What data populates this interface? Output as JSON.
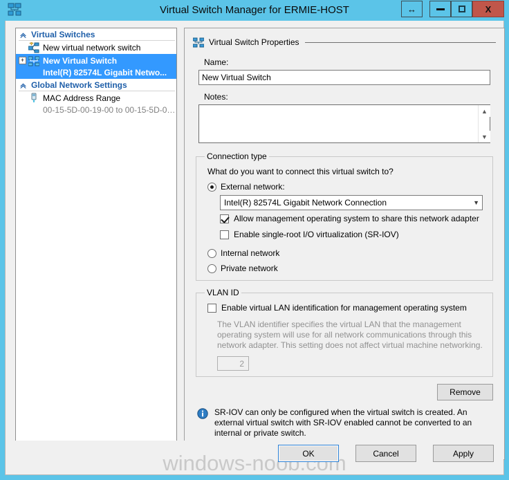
{
  "window": {
    "title": "Virtual Switch Manager for ERMIE-HOST",
    "app_icon": "virtual-switch-icon",
    "buttons": {
      "restore_label": "↔",
      "minimize_label": "",
      "maximize_label": "",
      "close_label": "X"
    }
  },
  "tree": {
    "sections": [
      {
        "label": "Virtual Switches",
        "items": [
          {
            "label": "New virtual network switch",
            "icon": "new-virtual-switch-icon",
            "selected": false,
            "sub": null,
            "expander": null
          },
          {
            "label": "New Virtual Switch",
            "icon": "virtual-switch-icon",
            "selected": true,
            "sub": "Intel(R) 82574L Gigabit Netwo...",
            "expander": "+"
          }
        ]
      },
      {
        "label": "Global Network Settings",
        "items": [
          {
            "label": "MAC Address Range",
            "icon": "mac-address-icon",
            "selected": false,
            "sub": "00-15-5D-00-19-00 to 00-15-5D-0…",
            "expander": null
          }
        ]
      }
    ]
  },
  "properties": {
    "header": "Virtual Switch Properties",
    "name_label": "Name:",
    "name_value": "New Virtual Switch",
    "notes_label": "Notes:",
    "notes_value": ""
  },
  "connection_type": {
    "legend": "Connection type",
    "question": "What do you want to connect this virtual switch to?",
    "external_label": "External network:",
    "external_selected": true,
    "adapter_value": "Intel(R) 82574L Gigabit Network Connection",
    "allow_management_label": "Allow management operating system to share this network adapter",
    "allow_management_checked": true,
    "sriov_label": "Enable single-root I/O virtualization (SR-IOV)",
    "sriov_checked": false,
    "internal_label": "Internal network",
    "internal_selected": false,
    "private_label": "Private network",
    "private_selected": false
  },
  "vlan": {
    "legend": "VLAN ID",
    "enable_label": "Enable virtual LAN identification for management operating system",
    "enable_checked": false,
    "description": "The VLAN identifier specifies the virtual LAN that the management operating system will use for all network communications through this network adapter. This setting does not affect virtual machine networking.",
    "id_value": "2"
  },
  "actions": {
    "remove_label": "Remove"
  },
  "info": {
    "icon": "info-icon",
    "text": "SR-IOV can only be configured when the virtual switch is created. An external virtual switch with SR-IOV enabled cannot be converted to an internal or private switch."
  },
  "footer": {
    "ok_label": "OK",
    "cancel_label": "Cancel",
    "apply_label": "Apply"
  },
  "watermark": "windows-noob.com",
  "colors": {
    "title_bar": "#5BC4E8",
    "close_button": "#C0564A",
    "selection": "#3399FF",
    "section_header": "#1F5FA9",
    "accent_focus": "#2A7FD4"
  }
}
